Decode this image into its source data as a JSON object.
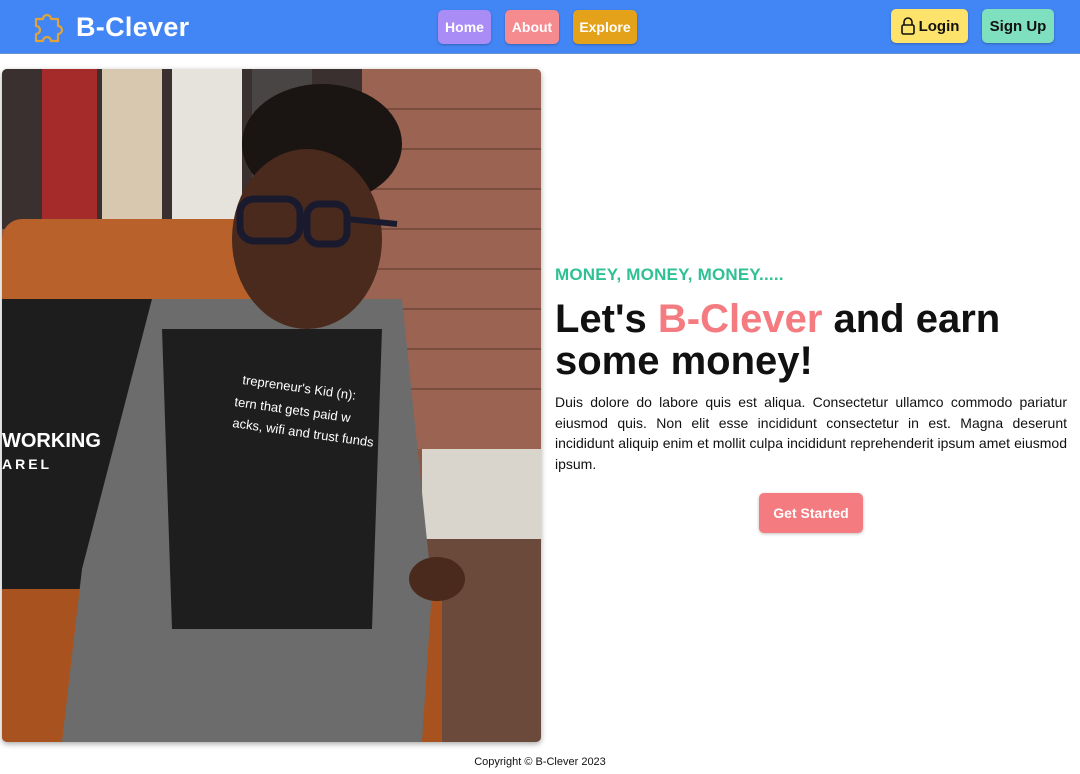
{
  "navbar": {
    "brand_name": "B-Clever",
    "brand_icon": "puzzle-icon",
    "nav_items": [
      {
        "label": "Home",
        "color": "#a98cf5"
      },
      {
        "label": "About",
        "color": "#f58a8f"
      },
      {
        "label": "Explore",
        "color": "#e4a21a"
      }
    ],
    "login_label": "Login",
    "login_icon": "lock-icon",
    "signup_label": "Sign Up",
    "background_color": "#4285f4"
  },
  "hero": {
    "image_alt": "Child in a plaid suit and glasses sitting on a leather chair",
    "kicker": "MONEY, MONEY, MONEY.....",
    "headline_before": "Let's ",
    "headline_accent": "B-Clever",
    "headline_after": " and earn some money!",
    "description": "Duis dolore do labore quis est aliqua. Consectetur ullamco commodo pariatur eiusmod quis. Non elit esse incididunt consectetur in est. Magna deserunt incididunt aliquip enim et mollit culpa incididunt reprehenderit ipsum amet eiusmod ipsum.",
    "cta_label": "Get Started",
    "accent_color": "#f47b7f",
    "kicker_color": "#2fc094"
  },
  "footer": {
    "copyright": "Copyright © B-Clever 2023"
  }
}
